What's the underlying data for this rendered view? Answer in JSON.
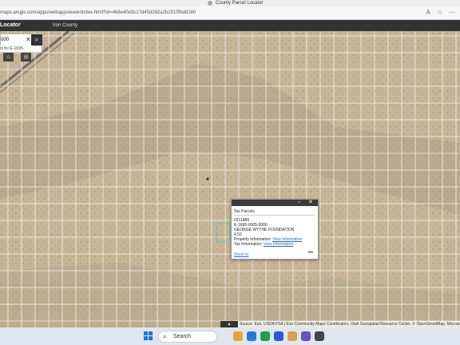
{
  "browser": {
    "tab_title": "County Parcel Locator",
    "url": "maps.arcgis.com/apps/webappviewer/index.html?id=4b8e40e3c17d45d282a2b1515fbdd160"
  },
  "app": {
    "title": "Locator",
    "subtitle": "Iron County"
  },
  "search": {
    "value": "000",
    "suggestion": "ts for E-1695-"
  },
  "popup": {
    "title": "Tax Parcels",
    "parcel_number": "0211885",
    "parcel_id": "E-1695-0005-0000",
    "owner": "GEORGE WYTHE FOUNDATION",
    "acres": "4.52",
    "property_info_label": "Property Information:",
    "property_info_link": "View Information",
    "tax_info_label": "Tax Information:",
    "tax_info_link": "View Information",
    "zoom_to": "Zoom to",
    "more": "•••"
  },
  "attribution": "Source: Esri, USDA FSA | Esri Community Maps Contributors, Utah Geospatial Resource Center, © OpenStreetMap, Microsoft",
  "taskbar": {
    "search_placeholder": "Search"
  },
  "colors": {
    "app_bar": "#333333",
    "parcel_lines": "#ffffff",
    "selection": "#27d3e8",
    "link": "#2b6fbd",
    "terrain": "#c7b596"
  }
}
